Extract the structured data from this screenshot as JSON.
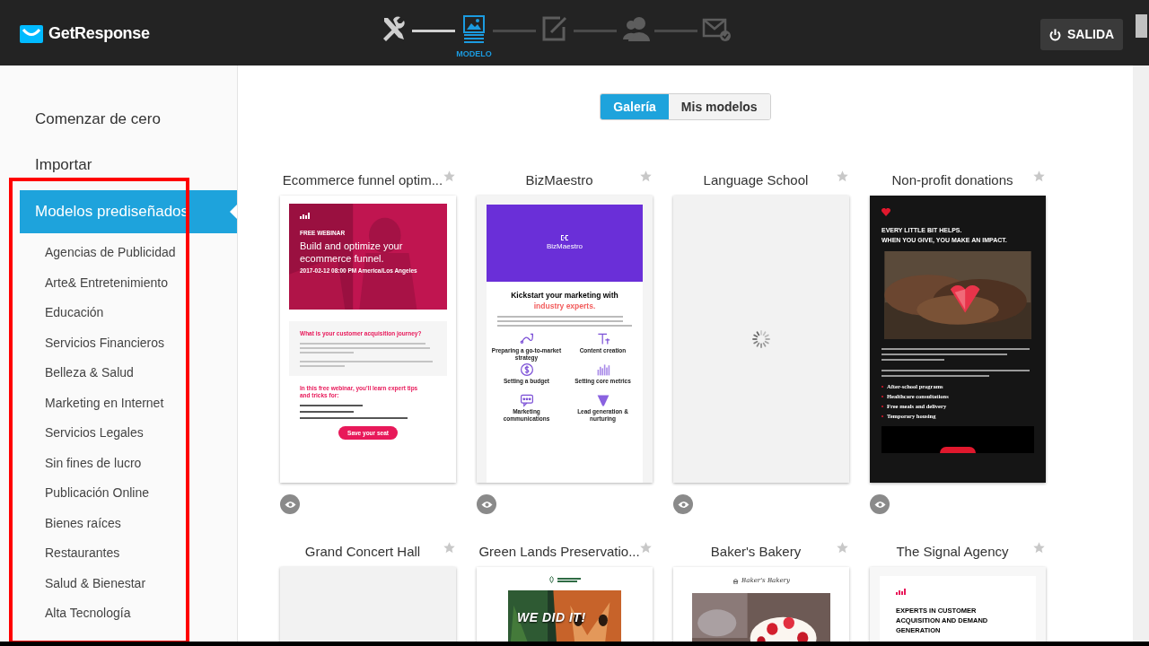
{
  "header": {
    "logo": "GetResponse",
    "steps": [
      {
        "kind": "tools",
        "completed": true,
        "selected": false
      },
      {
        "kind": "template",
        "completed": false,
        "selected": true,
        "label": "MODELO"
      },
      {
        "kind": "edit",
        "completed": false,
        "selected": false
      },
      {
        "kind": "contacts",
        "completed": false,
        "selected": false
      },
      {
        "kind": "send",
        "completed": false,
        "selected": false
      }
    ],
    "exit_button": "SALIDA"
  },
  "sidebar": {
    "items": [
      {
        "label": "Comenzar de cero",
        "selected": false
      },
      {
        "label": "Importar",
        "selected": false
      },
      {
        "label": "Modelos prediseñados",
        "selected": true
      }
    ],
    "categories": [
      "Agencias de Publicidad",
      "Arte& Entretenimiento",
      "Educación",
      "Servicios Financieros",
      "Belleza & Salud",
      "Marketing en Internet",
      "Servicios Legales",
      "Sin fines de lucro",
      "Publicación Online",
      "Bienes raíces",
      "Restaurantes",
      "Salud & Bienestar",
      "Alta Tecnología"
    ]
  },
  "tabs": [
    {
      "label": "Galería",
      "selected": true
    },
    {
      "label": "Mis modelos",
      "selected": false
    }
  ],
  "templates": [
    {
      "title": "Ecommerce funnel optim...",
      "starred": false,
      "preview": {
        "kind": "webinar",
        "eyebrow": "FREE WEBINAR",
        "heading": "Build and optimize your ecommerce funnel.",
        "date": "2017-02-12 08:00 PM America/Los Angeles",
        "box_title": "What is your customer acquisition journey?",
        "subheading": "In this free webinar, you'll learn expert tips and tricks for:",
        "button": "Save your seat"
      }
    },
    {
      "title": "BizMaestro",
      "starred": false,
      "preview": {
        "kind": "services",
        "logo": "BizMaestro",
        "heading": "Kickstart your marketing with",
        "heading_accent": "industry experts.",
        "services": [
          {
            "kind": "route",
            "label": "Preparing a go-to-market strategy"
          },
          {
            "kind": "text",
            "label": "Content creation"
          },
          {
            "kind": "dollar",
            "label": "Setting a budget"
          },
          {
            "kind": "chart",
            "label": "Setting core metrics"
          },
          {
            "kind": "chat",
            "label": "Marketing communications"
          },
          {
            "kind": "funnel",
            "label": "Lead generation & nurturing"
          }
        ]
      }
    },
    {
      "title": "Language School",
      "starred": false,
      "preview": {
        "kind": "loading"
      }
    },
    {
      "title": "Non-profit donations",
      "starred": false,
      "preview": {
        "kind": "donation",
        "heading_lines": [
          "EVERY LITTLE BIT HELPS.",
          "WHEN YOU GIVE, YOU MAKE AN IMPACT."
        ],
        "bullets": [
          "After-school programs",
          "Healthcare consultations",
          "Free meals and delivery",
          "Temporary housing"
        ]
      }
    },
    {
      "title": "Grand Concert Hall",
      "starred": false,
      "preview": {
        "kind": "blank"
      }
    },
    {
      "title": "Green Lands Preservatio...",
      "starred": false,
      "preview": {
        "kind": "photo_headline",
        "headline": "WE DID IT!"
      }
    },
    {
      "title": "Baker's Bakery",
      "starred": false,
      "preview": {
        "logo": "Baker's Bakery"
      }
    },
    {
      "title": "The Signal Agency",
      "starred": false,
      "preview": {
        "kind": "agency",
        "heading": "EXPERTS IN CUSTOMER ACQUISITION AND DEMAND GENERATION"
      }
    }
  ]
}
